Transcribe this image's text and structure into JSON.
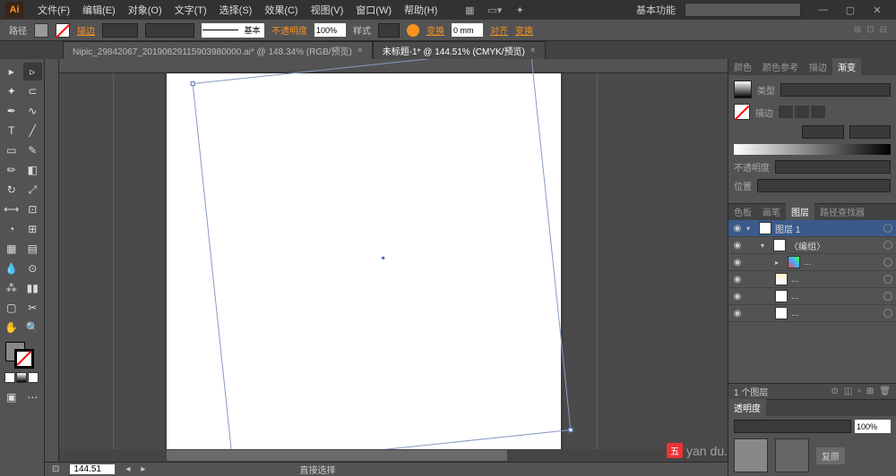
{
  "app": {
    "logo": "Ai"
  },
  "menu": {
    "file": "文件(F)",
    "edit": "编辑(E)",
    "object": "对象(O)",
    "type": "文字(T)",
    "select": "选择(S)",
    "effect": "效果(C)",
    "view": "视图(V)",
    "window": "窗口(W)",
    "help": "帮助(H)"
  },
  "titlebar": {
    "workspace": "基本功能"
  },
  "control": {
    "label": "路径",
    "stroke_link": "描边",
    "basic": "基本",
    "opacity_label": "不透明度",
    "opacity_val": "100%",
    "style_label": "样式",
    "transform_link": "变换",
    "align_input": "0 mm",
    "align_label1": "对齐",
    "align_label2": "变换"
  },
  "tabs": {
    "tab1": "Nipic_29842067_20190829115903980000.ai* @ 148.34% (RGB/预览)",
    "tab2": "未标题-1* @ 144.51% (CMYK/预览)"
  },
  "status": {
    "zoom": "144.51",
    "tool": "直接选择"
  },
  "panels": {
    "color": "颜色",
    "color_guide": "颜色参考",
    "swatches": "描边",
    "gradient": "渐变",
    "type_label": "类型",
    "stroke_label": "描边",
    "opacity_label": "不透明度",
    "position_label": "位置"
  },
  "layers": {
    "tab_artboard": "色板",
    "tab_brushes": "画笔",
    "tab_layers": "图层",
    "tab_symbols": "路径查找器",
    "layer1": "图层 1",
    "group": "〈编组〉",
    "footer_count": "1 个图层"
  },
  "appearance": {
    "tab": "透明度",
    "opacity": "100%",
    "default": "复原"
  },
  "watermark": {
    "badge": "五",
    "text1": "yan",
    "text2": "du."
  }
}
